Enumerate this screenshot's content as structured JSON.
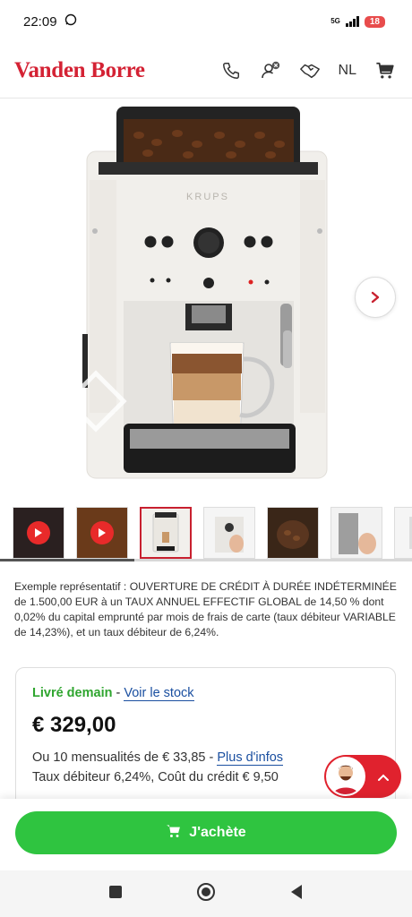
{
  "status": {
    "time": "22:09",
    "network": "5G",
    "battery": "18"
  },
  "header": {
    "logo": "Vanden Borre",
    "lang": "NL"
  },
  "gallery": {
    "brand_mark": "KRUPS"
  },
  "credit_text": "Exemple représentatif : OUVERTURE DE CRÉDIT À DURÉE INDÉTERMINÉE de 1.500,00 EUR à un TAUX ANNUEL EFFECTIF GLOBAL de 14,50 % dont 0,02% du capital emprunté par mois de frais de carte (taux débiteur VARIABLE de 14,23%), et un taux débiteur de 6,24%.",
  "card": {
    "delivery": "Livré demain",
    "sep": " - ",
    "stock_link": "Voir le stock",
    "price": "€ 329,00",
    "monthly": "Ou 10 mensualités de € 33,85 - ",
    "more_info": "Plus d'infos",
    "rate": "Taux débiteur 6,24%, Coût du crédit € 9,50"
  },
  "cta": {
    "label": "J'achète"
  },
  "colors": {
    "brand": "#d42234",
    "green": "#2fc440",
    "link": "#1a4fa0"
  }
}
